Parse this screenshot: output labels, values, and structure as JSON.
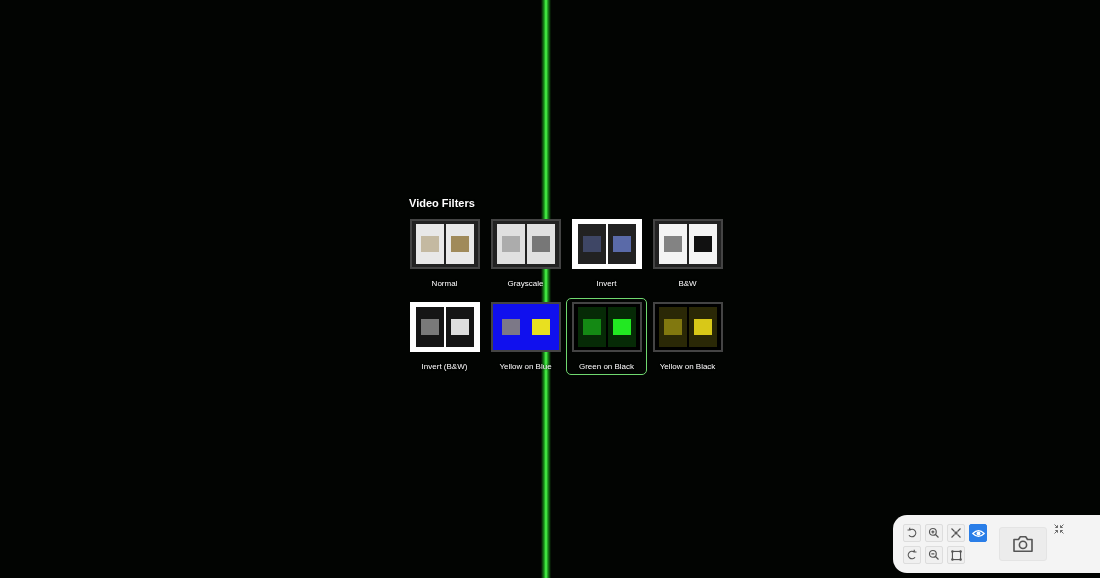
{
  "filters_panel": {
    "title": "Video Filters",
    "filters": [
      {
        "label": "Normal",
        "kind": "normal",
        "selected": false
      },
      {
        "label": "Grayscale",
        "kind": "grayscale",
        "selected": false
      },
      {
        "label": "Invert",
        "kind": "invert",
        "selected": false
      },
      {
        "label": "B&W",
        "kind": "bw",
        "selected": false
      },
      {
        "label": "Invert (B&W)",
        "kind": "invert-bw",
        "selected": false
      },
      {
        "label": "Yellow on Blue",
        "kind": "yellow-blue",
        "selected": false
      },
      {
        "label": "Green on Black",
        "kind": "green-black",
        "selected": true
      },
      {
        "label": "Yellow on Black",
        "kind": "yellow-black",
        "selected": false
      }
    ]
  },
  "toolbar": {
    "tools": [
      {
        "kind": "rotate-left",
        "selected": false
      },
      {
        "kind": "zoom-in",
        "selected": false
      },
      {
        "kind": "fit",
        "selected": false
      },
      {
        "kind": "eye",
        "selected": true
      },
      {
        "kind": "rotate-right",
        "selected": false
      },
      {
        "kind": "zoom-out",
        "selected": false
      },
      {
        "kind": "crop",
        "selected": false
      }
    ]
  }
}
